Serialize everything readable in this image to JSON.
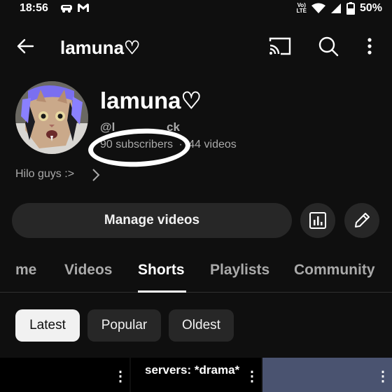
{
  "status": {
    "time": "18:56",
    "battery": "50%",
    "network_line1": "Vo)",
    "network_line2": "LTE"
  },
  "header": {
    "title": "lamuna♡"
  },
  "channel": {
    "name": "lamuna♡",
    "handle": "@l",
    "handle_tail": "ck",
    "subscribers": "90 subscribers",
    "separator": "·",
    "videos": "44 videos",
    "description": "Hilo guys :>"
  },
  "actions": {
    "manage_label": "Manage videos"
  },
  "tabs": [
    {
      "label": "me"
    },
    {
      "label": "Videos"
    },
    {
      "label": "Shorts"
    },
    {
      "label": "Playlists"
    },
    {
      "label": "Community"
    }
  ],
  "active_tab": "Shorts",
  "chips": [
    {
      "label": "Latest"
    },
    {
      "label": "Popular"
    },
    {
      "label": "Oldest"
    }
  ],
  "selected_chip": "Latest",
  "shorts": [
    {
      "title": ""
    },
    {
      "title": "servers: *drama*"
    },
    {
      "title": ""
    }
  ],
  "colors": {
    "background": "#0f0f0f",
    "surface": "#272727",
    "muted_text": "#aaaaaa",
    "short_tile_blue": "#4a5370"
  }
}
